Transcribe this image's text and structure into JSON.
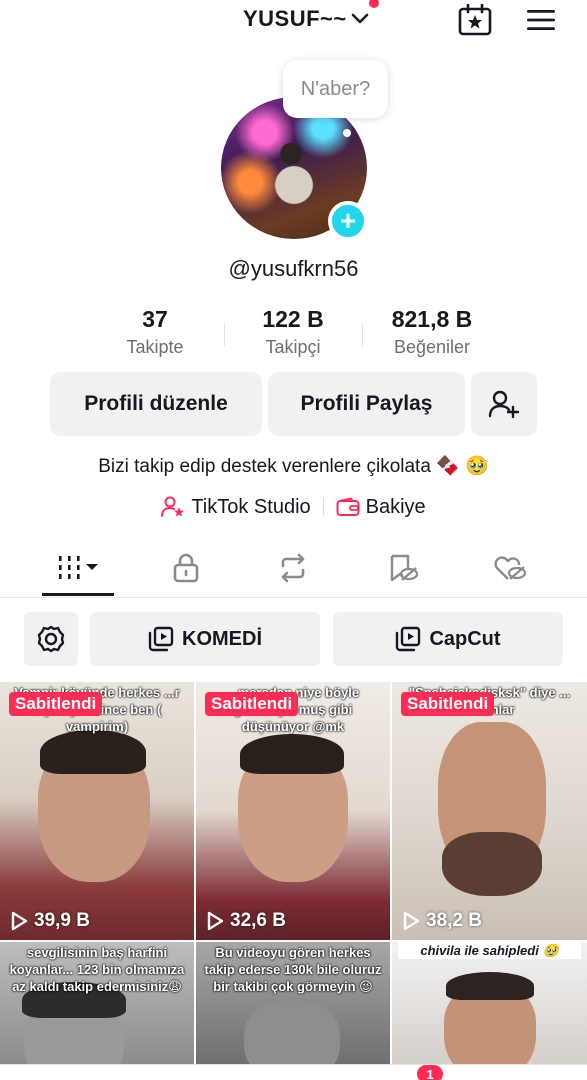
{
  "header": {
    "username": "YUSUF~~",
    "chevron": "chevron-down-icon",
    "calendar_icon": "calendar-star-icon",
    "menu_icon": "hamburger-menu-icon"
  },
  "profile": {
    "bubble_text": "N'aber?",
    "handle": "@yusufkrn56",
    "add_icon": "+"
  },
  "stats": [
    {
      "value": "37",
      "label": "Takipte"
    },
    {
      "value": "122 B",
      "label": "Takipçi"
    },
    {
      "value": "821,8 B",
      "label": "Beğeniler"
    }
  ],
  "buttons": {
    "edit": "Profili düzenle",
    "share": "Profili Paylaş",
    "add_friend_icon": "add-user-icon"
  },
  "bio": "Bizi takip edip destek verenlere çikolata 🍫 🥹",
  "links": {
    "studio": "TikTok Studio",
    "balance": "Bakiye"
  },
  "tabs": [
    "videos-grid-icon",
    "lock-icon",
    "repost-icon",
    "saved-icon",
    "liked-icon"
  ],
  "filters": {
    "settings_icon": "gear-icon",
    "playlist1": "KOMEDİ",
    "playlist2": "CapCut"
  },
  "videos": [
    {
      "pinned": "Sabitlendi",
      "caption": "Vampir köyünde herkes ...r diye oy verince ben ( vampirim)",
      "views": "39,9 B"
    },
    {
      "pinned": "Sabitlendi",
      "caption": "...maradan niye böyle görünüyormuş gibi düşünüyor @mk",
      "views": "32,6 B"
    },
    {
      "pinned": "Sabitlendi",
      "caption": "\"Spshsiskadisksk\" diye ... insanlar",
      "views": "38,2 B"
    },
    {
      "caption": "sevgilisinin baş harfini koyanlar... 123 bin olmamıza az kaldı takip edermisiniz😩"
    },
    {
      "caption": "Bu videoyu gören herkes takip ederse 130k bile oluruz bir takibi çok görmeyin 😉"
    },
    {
      "caption": "chivila ile sahipledi 🥹"
    }
  ],
  "nav": {
    "badge": "1"
  },
  "colors": {
    "accent": "#fe2c55",
    "teal": "#20d5ec",
    "button_bg": "#f1f1f2"
  }
}
